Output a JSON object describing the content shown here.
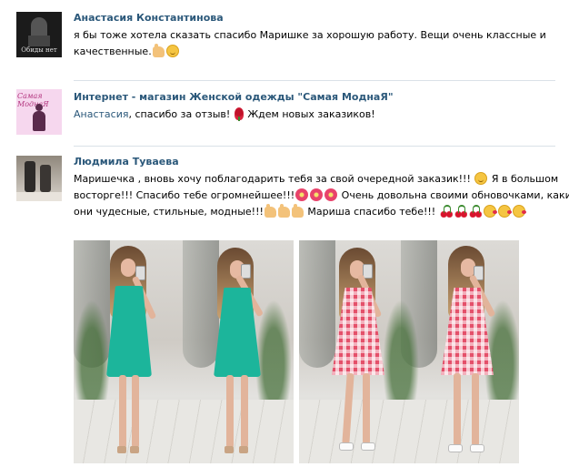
{
  "comments": [
    {
      "author": "Анастасия Константинова",
      "avatar_caption": "Обиды нет",
      "text": "я бы тоже хотела сказать спасибо Маришке за хорошую работу. Вещи очень классные и качественные."
    },
    {
      "author": "Интернет - магазин Женской одежды \"Самая МоднаЯ\"",
      "avatar_caption": "Самая МоднаЯ",
      "mention": "Анастасия",
      "text_after_mention": ", спасибо за отзыв!",
      "text_end": "Ждем новых заказиков!"
    },
    {
      "author": "Людмила Туваева",
      "line1_a": "Маришечка , вновь хочу поблагодарить тебя за свой очередной заказик!!!",
      "line1_b": "Я в большом",
      "line2_a": "восторге!!! Спасибо тебе огромнейшее!!!",
      "line2_b": "Очень довольна своими обновочками, какие же",
      "line3_a": "они чудесные, стильные, модные!!!",
      "line3_b": "Мариша спасибо тебе!!!"
    }
  ],
  "photos": [
    {
      "dress": "turquoise dress",
      "dress_color": "#1cb59b",
      "shoes": "studded sandals"
    },
    {
      "dress": "red gingham dress",
      "dress_color": "#e4506a",
      "shoes": "white sneakers"
    }
  ],
  "colors": {
    "link": "#2b587a",
    "separator": "#dae1e8"
  }
}
